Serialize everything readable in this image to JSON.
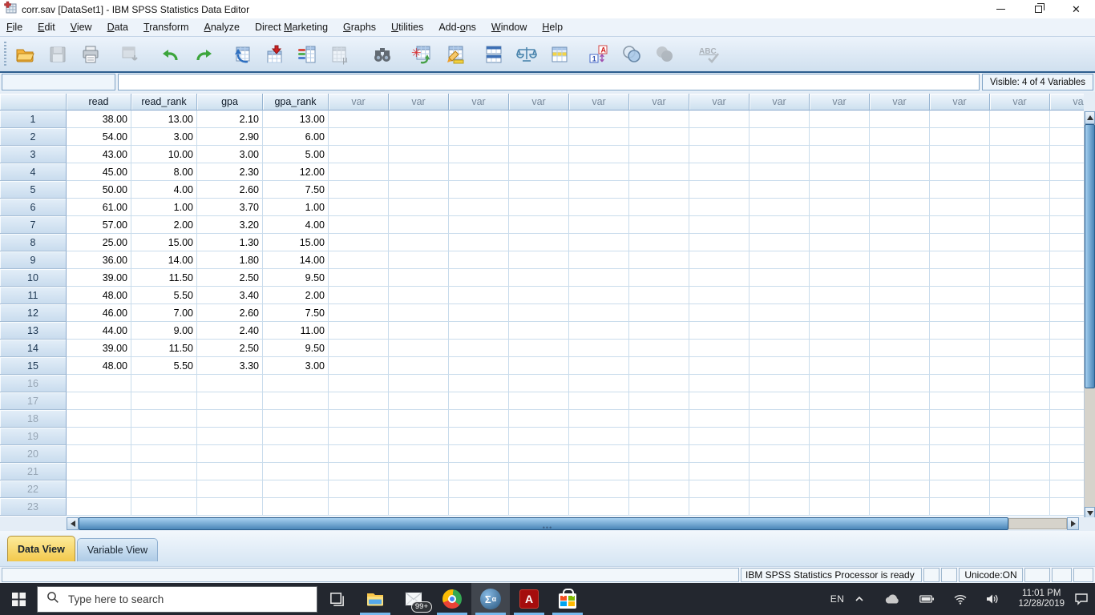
{
  "window": {
    "title": "corr.sav [DataSet1] - IBM SPSS Statistics Data Editor"
  },
  "menu_bar": {
    "items": [
      {
        "label": "File",
        "underline_index": 0
      },
      {
        "label": "Edit",
        "underline_index": 0
      },
      {
        "label": "View",
        "underline_index": 0
      },
      {
        "label": "Data",
        "underline_index": 0
      },
      {
        "label": "Transform",
        "underline_index": 0
      },
      {
        "label": "Analyze",
        "underline_index": 0
      },
      {
        "label": "Direct Marketing",
        "underline_index": 7
      },
      {
        "label": "Graphs",
        "underline_index": 0
      },
      {
        "label": "Utilities",
        "underline_index": 0
      },
      {
        "label": "Add-ons",
        "underline_index": 4
      },
      {
        "label": "Window",
        "underline_index": 0
      },
      {
        "label": "Help",
        "underline_index": 0
      }
    ]
  },
  "toolbar": {
    "buttons": [
      {
        "name": "open-data",
        "disabled": false
      },
      {
        "name": "save",
        "disabled": true
      },
      {
        "name": "print",
        "disabled": false
      },
      {
        "name": "recall-dialogs",
        "disabled": true
      },
      {
        "name": "undo",
        "disabled": false
      },
      {
        "name": "redo",
        "disabled": false
      },
      {
        "name": "goto-case",
        "disabled": false
      },
      {
        "name": "goto-variable",
        "disabled": false
      },
      {
        "name": "variables",
        "disabled": false
      },
      {
        "name": "descriptive-statistics",
        "disabled": true
      },
      {
        "name": "find",
        "disabled": false
      },
      {
        "name": "insert-cases",
        "disabled": false
      },
      {
        "name": "insert-variable",
        "disabled": false
      },
      {
        "name": "split-file",
        "disabled": false
      },
      {
        "name": "weight-cases",
        "disabled": false
      },
      {
        "name": "select-cases",
        "disabled": false
      },
      {
        "name": "value-labels-toggle",
        "disabled": false
      },
      {
        "name": "use-variable-sets",
        "disabled": false
      },
      {
        "name": "show-all-variables",
        "disabled": true
      },
      {
        "name": "spell-check",
        "disabled": true
      }
    ]
  },
  "cell_editor": {
    "cell_reference": "",
    "cell_value": "",
    "visible_info": "Visible: 4 of 4 Variables"
  },
  "data_grid": {
    "columns": [
      "read",
      "read_rank",
      "gpa",
      "gpa_rank"
    ],
    "var_placeholder": "var",
    "var_column_count": 13,
    "rows": [
      {
        "case": "1",
        "values": [
          "38.00",
          "13.00",
          "2.10",
          "13.00"
        ]
      },
      {
        "case": "2",
        "values": [
          "54.00",
          "3.00",
          "2.90",
          "6.00"
        ]
      },
      {
        "case": "3",
        "values": [
          "43.00",
          "10.00",
          "3.00",
          "5.00"
        ]
      },
      {
        "case": "4",
        "values": [
          "45.00",
          "8.00",
          "2.30",
          "12.00"
        ]
      },
      {
        "case": "5",
        "values": [
          "50.00",
          "4.00",
          "2.60",
          "7.50"
        ]
      },
      {
        "case": "6",
        "values": [
          "61.00",
          "1.00",
          "3.70",
          "1.00"
        ]
      },
      {
        "case": "7",
        "values": [
          "57.00",
          "2.00",
          "3.20",
          "4.00"
        ]
      },
      {
        "case": "8",
        "values": [
          "25.00",
          "15.00",
          "1.30",
          "15.00"
        ]
      },
      {
        "case": "9",
        "values": [
          "36.00",
          "14.00",
          "1.80",
          "14.00"
        ]
      },
      {
        "case": "10",
        "values": [
          "39.00",
          "11.50",
          "2.50",
          "9.50"
        ]
      },
      {
        "case": "11",
        "values": [
          "48.00",
          "5.50",
          "3.40",
          "2.00"
        ]
      },
      {
        "case": "12",
        "values": [
          "46.00",
          "7.00",
          "2.60",
          "7.50"
        ]
      },
      {
        "case": "13",
        "values": [
          "44.00",
          "9.00",
          "2.40",
          "11.00"
        ]
      },
      {
        "case": "14",
        "values": [
          "39.00",
          "11.50",
          "2.50",
          "9.50"
        ]
      },
      {
        "case": "15",
        "values": [
          "48.00",
          "5.50",
          "3.30",
          "3.00"
        ]
      }
    ],
    "empty_row_numbers": [
      "16",
      "17",
      "18",
      "19",
      "20",
      "21",
      "22",
      "23"
    ]
  },
  "view_tabs": [
    {
      "label": "Data View",
      "active": true
    },
    {
      "label": "Variable View",
      "active": false
    }
  ],
  "status_bar": {
    "processor": "IBM SPSS Statistics Processor is ready",
    "unicode": "Unicode:ON"
  },
  "taskbar": {
    "search_placeholder": "Type here to search",
    "apps": [
      {
        "name": "task-view",
        "running": false,
        "active": false
      },
      {
        "name": "file-explorer",
        "running": true,
        "active": false
      },
      {
        "name": "mail",
        "running": false,
        "active": false,
        "badge": "99+"
      },
      {
        "name": "chrome",
        "running": true,
        "active": false
      },
      {
        "name": "spss",
        "running": true,
        "active": true
      },
      {
        "name": "acrobat",
        "running": true,
        "active": false
      },
      {
        "name": "microsoft-store",
        "running": true,
        "active": false
      }
    ],
    "tray": {
      "language": "EN",
      "icons": [
        "chevron-up",
        "onedrive",
        "battery",
        "wifi",
        "volume"
      ],
      "time": "11:01 PM",
      "date": "12/28/2019"
    }
  }
}
